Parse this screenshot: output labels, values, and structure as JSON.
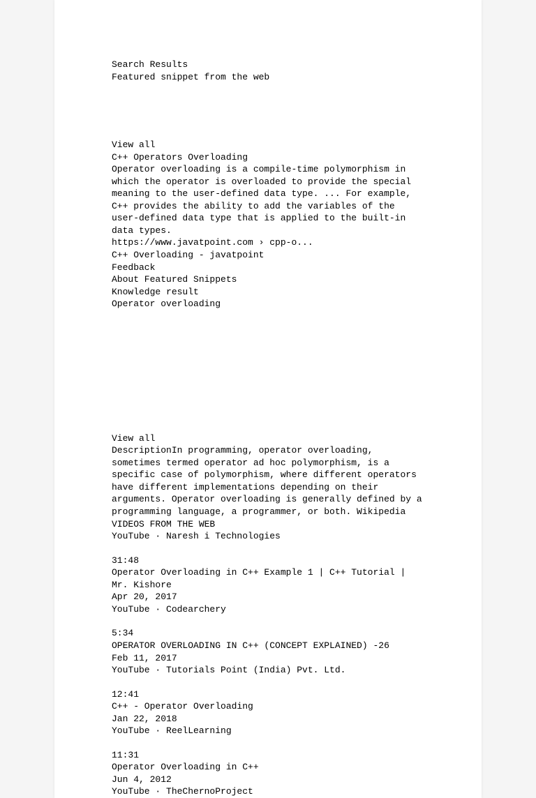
{
  "header": {
    "search_results": "Search Results",
    "featured_label": "Featured snippet from the web"
  },
  "snippet": {
    "view_all": "View all",
    "title": "C++ Operators Overloading",
    "body": "Operator overloading is a compile-time polymorphism in which the operator is overloaded to provide the special meaning to the user-defined data type. ... For example, C++ provides the ability to add the variables of the user-defined data type that is applied to the built-in data types.",
    "url": "https://www.javatpoint.com › cpp-o...",
    "link_title": "C++ Overloading - javatpoint",
    "feedback": "Feedback",
    "about": "About Featured Snippets",
    "knowledge_label": "Knowledge result",
    "knowledge_title": "Operator overloading"
  },
  "knowledge": {
    "view_all": "View all",
    "description": "DescriptionIn programming, operator overloading, sometimes termed operator ad hoc polymorphism, is a specific case of polymorphism, where different operators have different implementations depending on their arguments. Operator overloading is generally defined by a programming language, a programmer, or both. Wikipedia",
    "videos_label": "VIDEOS FROM THE WEB"
  },
  "videos": [
    {
      "source": "YouTube · Naresh i Technologies",
      "duration": "31:48",
      "title": "Operator Overloading in C++ Example 1 | C++ Tutorial | Mr. Kishore",
      "date": "Apr 20, 2017"
    },
    {
      "source": "YouTube · Codearchery",
      "duration": "5:34",
      "title": "OPERATOR OVERLOADING IN C++ (CONCEPT EXPLAINED) -26",
      "date": "Feb 11, 2017"
    },
    {
      "source": "YouTube · Tutorials Point (India) Pvt. Ltd.",
      "duration": "12:41",
      "title": "C++ - Operator Overloading",
      "date": "Jan 22, 2018"
    },
    {
      "source": "YouTube · ReelLearning",
      "duration": "11:31",
      "title": "Operator Overloading in C++",
      "date": "Jun 4, 2012"
    },
    {
      "source": "YouTube · TheChernoProject",
      "duration": "",
      "title": "",
      "date": ""
    }
  ]
}
